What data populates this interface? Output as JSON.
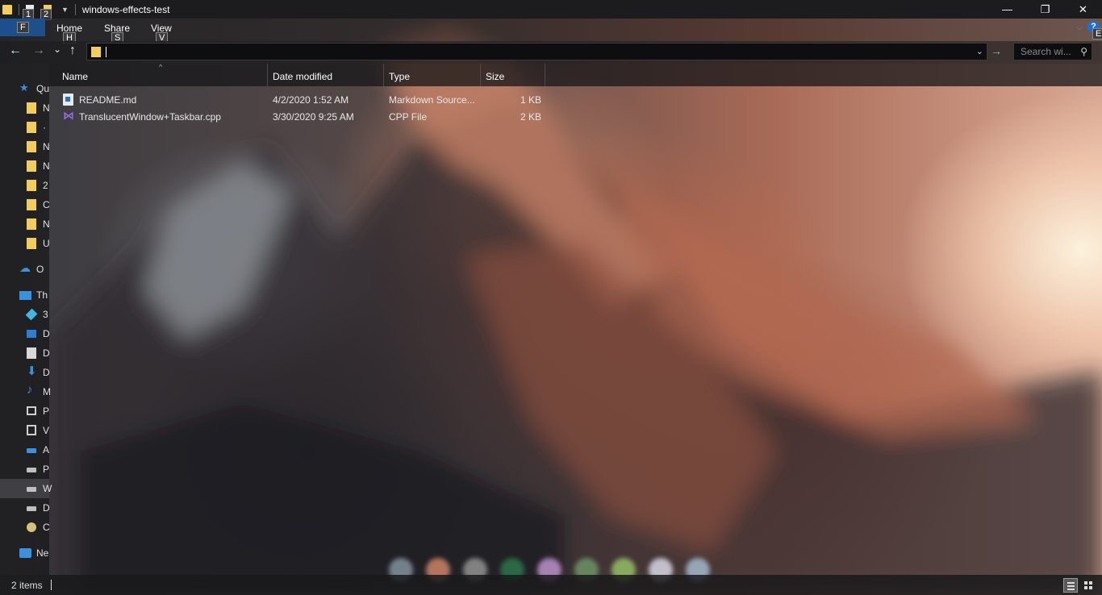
{
  "window": {
    "title": "windows-effects-test",
    "minimize": "—",
    "maximize": "❐",
    "close": "✕"
  },
  "quick_access": {
    "keytips": [
      "1",
      "2"
    ],
    "file_keytip": "F"
  },
  "ribbon": {
    "tabs": [
      {
        "label": "Home",
        "keytip": "H"
      },
      {
        "label": "Share",
        "keytip": "S"
      },
      {
        "label": "View",
        "keytip": "V"
      }
    ],
    "expand_glyph": "⌵",
    "help_glyph": "?",
    "help_keytip": "E"
  },
  "nav": {
    "back": "←",
    "forward": "→",
    "recent": "⌄",
    "up": "↑",
    "go": "→",
    "address_dropdown": "⌄"
  },
  "search": {
    "placeholder": "Search wi...",
    "icon": "⚲"
  },
  "nav_pane": {
    "quick_access_label": "Qu",
    "quick_access_items": [
      "N",
      "·",
      "N",
      "N",
      "2",
      "C",
      "N",
      "U"
    ],
    "onedrive_label": "O",
    "this_pc_label": "Th",
    "this_pc_items": [
      {
        "icon": "3d-objects",
        "label": "3"
      },
      {
        "icon": "desktop",
        "label": "D"
      },
      {
        "icon": "documents",
        "label": "D"
      },
      {
        "icon": "downloads",
        "label": "D"
      },
      {
        "icon": "music",
        "label": "M"
      },
      {
        "icon": "pictures",
        "label": "P"
      },
      {
        "icon": "videos",
        "label": "V"
      },
      {
        "icon": "network-drive",
        "label": "A"
      },
      {
        "icon": "drive",
        "label": "P"
      },
      {
        "icon": "drive",
        "label": "W"
      },
      {
        "icon": "drive",
        "label": "D"
      },
      {
        "icon": "dvd",
        "label": "C"
      }
    ],
    "network_label": "Ne"
  },
  "columns": [
    "Name",
    "Date modified",
    "Type",
    "Size"
  ],
  "sort_indicator": "^",
  "files": [
    {
      "name": "README.md",
      "date": "4/2/2020 1:52 AM",
      "type": "Markdown Source...",
      "size": "1 KB",
      "icon": "markdown-file-icon"
    },
    {
      "name": "TranslucentWindow+Taskbar.cpp",
      "date": "3/30/2020 9:25 AM",
      "type": "CPP File",
      "size": "2 KB",
      "icon": "visual-studio-icon"
    }
  ],
  "status": {
    "item_count": "2 items"
  },
  "dock_colors": [
    "#8a9aa8",
    "#d98b6a",
    "#9a9a9a",
    "#2e7a4e",
    "#c79ad8",
    "#6f9a6a",
    "#9ac86a",
    "#e2e2f0",
    "#a8c2d8"
  ]
}
